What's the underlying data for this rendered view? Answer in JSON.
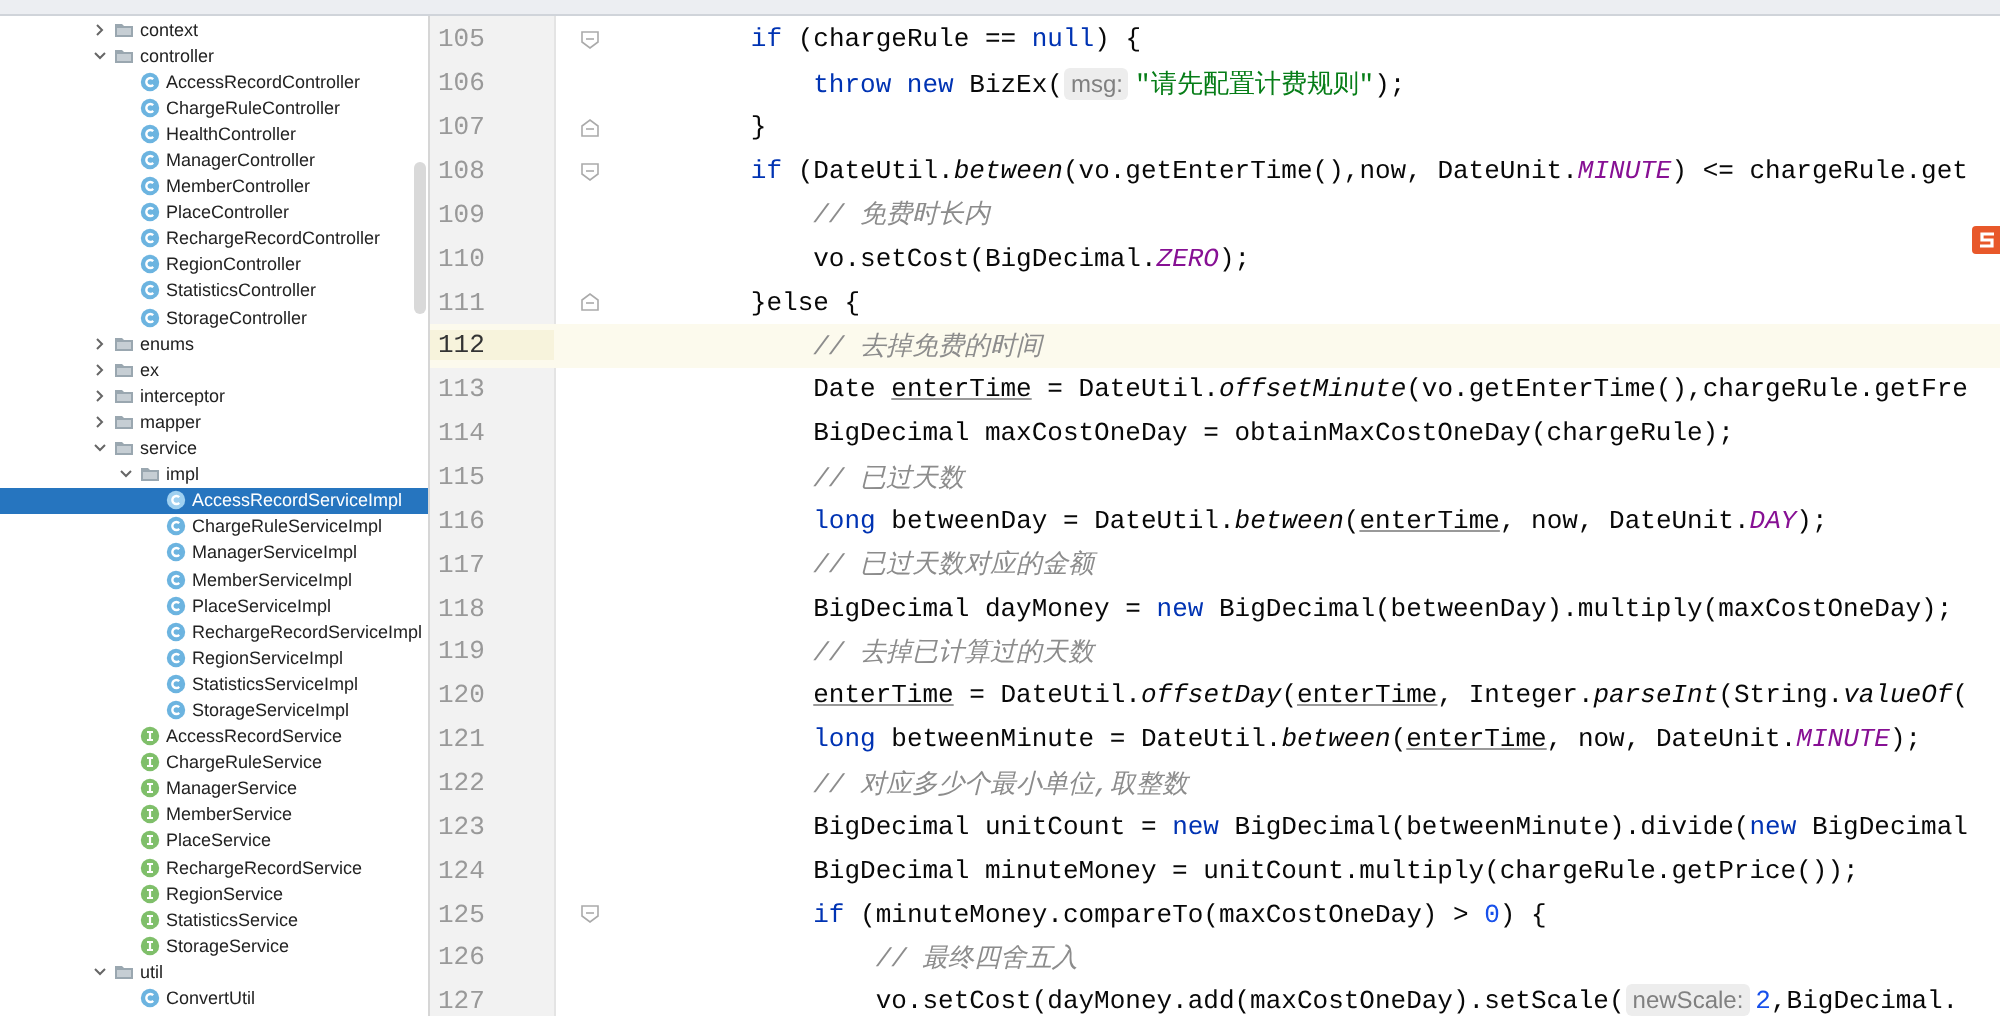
{
  "project_tree": [
    {
      "label": "context",
      "kind": "folder",
      "expanded": false,
      "selected": false
    },
    {
      "label": "controller",
      "kind": "folder",
      "expanded": true,
      "selected": false,
      "children": [
        {
          "label": "AccessRecordController",
          "kind": "class",
          "selected": false
        },
        {
          "label": "ChargeRuleController",
          "kind": "class",
          "selected": false
        },
        {
          "label": "HealthController",
          "kind": "class",
          "selected": false
        },
        {
          "label": "ManagerController",
          "kind": "class",
          "selected": false
        },
        {
          "label": "MemberController",
          "kind": "class",
          "selected": false
        },
        {
          "label": "PlaceController",
          "kind": "class",
          "selected": false
        },
        {
          "label": "RechargeRecordController",
          "kind": "class",
          "selected": false
        },
        {
          "label": "RegionController",
          "kind": "class",
          "selected": false
        },
        {
          "label": "StatisticsController",
          "kind": "class",
          "selected": false
        },
        {
          "label": "StorageController",
          "kind": "class",
          "selected": false
        }
      ]
    },
    {
      "label": "enums",
      "kind": "folder",
      "expanded": false,
      "selected": false
    },
    {
      "label": "ex",
      "kind": "folder",
      "expanded": false,
      "selected": false
    },
    {
      "label": "interceptor",
      "kind": "folder",
      "expanded": false,
      "selected": false
    },
    {
      "label": "mapper",
      "kind": "folder",
      "expanded": false,
      "selected": false
    },
    {
      "label": "service",
      "kind": "folder",
      "expanded": true,
      "selected": false,
      "children": [
        {
          "label": "impl",
          "kind": "folder",
          "expanded": true,
          "selected": false,
          "children": [
            {
              "label": "AccessRecordServiceImpl",
              "kind": "class",
              "selected": true
            },
            {
              "label": "ChargeRuleServiceImpl",
              "kind": "class",
              "selected": false
            },
            {
              "label": "ManagerServiceImpl",
              "kind": "class",
              "selected": false
            },
            {
              "label": "MemberServiceImpl",
              "kind": "class",
              "selected": false
            },
            {
              "label": "PlaceServiceImpl",
              "kind": "class",
              "selected": false
            },
            {
              "label": "RechargeRecordServiceImpl",
              "kind": "class",
              "selected": false
            },
            {
              "label": "RegionServiceImpl",
              "kind": "class",
              "selected": false
            },
            {
              "label": "StatisticsServiceImpl",
              "kind": "class",
              "selected": false
            },
            {
              "label": "StorageServiceImpl",
              "kind": "class",
              "selected": false
            }
          ]
        },
        {
          "label": "AccessRecordService",
          "kind": "interface",
          "selected": false
        },
        {
          "label": "ChargeRuleService",
          "kind": "interface",
          "selected": false
        },
        {
          "label": "ManagerService",
          "kind": "interface",
          "selected": false
        },
        {
          "label": "MemberService",
          "kind": "interface",
          "selected": false
        },
        {
          "label": "PlaceService",
          "kind": "interface",
          "selected": false
        },
        {
          "label": "RechargeRecordService",
          "kind": "interface",
          "selected": false
        },
        {
          "label": "RegionService",
          "kind": "interface",
          "selected": false
        },
        {
          "label": "StatisticsService",
          "kind": "interface",
          "selected": false
        },
        {
          "label": "StorageService",
          "kind": "interface",
          "selected": false
        }
      ]
    },
    {
      "label": "util",
      "kind": "folder",
      "expanded": true,
      "selected": false,
      "children": [
        {
          "label": "ConvertUtil",
          "kind": "class",
          "selected": false
        }
      ]
    }
  ],
  "editor": {
    "lines": [
      {
        "number": "105",
        "current": false,
        "fold_start": true,
        "tokens": [
          {
            "kind": "kw",
            "text": "        if"
          },
          {
            "kind": "text",
            "text": " (chargeRule == "
          },
          {
            "kind": "kw",
            "text": "null"
          },
          {
            "kind": "text",
            "text": ") {"
          }
        ]
      },
      {
        "number": "106",
        "current": false,
        "tokens": [
          {
            "kind": "kw",
            "text": "            throw new"
          },
          {
            "kind": "text",
            "text": " BizEx("
          },
          {
            "kind": "hint",
            "text": "msg:"
          },
          {
            "kind": "string",
            "text": "\"请先配置计费规则\""
          },
          {
            "kind": "text",
            "text": ");"
          }
        ]
      },
      {
        "number": "107",
        "current": false,
        "fold_end": true,
        "tokens": [
          {
            "kind": "text",
            "text": "        }"
          }
        ]
      },
      {
        "number": "108",
        "current": false,
        "fold_start": true,
        "tokens": [
          {
            "kind": "kw",
            "text": "        if"
          },
          {
            "kind": "text",
            "text": " (DateUtil."
          },
          {
            "kind": "static",
            "text": "between"
          },
          {
            "kind": "text",
            "text": "(vo.getEnterTime(),now, DateUnit."
          },
          {
            "kind": "const",
            "text": "MINUTE"
          },
          {
            "kind": "text",
            "text": ") <= chargeRule.get"
          }
        ]
      },
      {
        "number": "109",
        "current": false,
        "tokens": [
          {
            "kind": "comment",
            "text": "            // 免费时长内"
          }
        ]
      },
      {
        "number": "110",
        "current": false,
        "tokens": [
          {
            "kind": "text",
            "text": "            vo.setCost(BigDecimal."
          },
          {
            "kind": "const",
            "text": "ZERO"
          },
          {
            "kind": "text",
            "text": ");"
          }
        ]
      },
      {
        "number": "111",
        "current": false,
        "fold_end": true,
        "tokens": [
          {
            "kind": "text",
            "text": "        }else {"
          }
        ]
      },
      {
        "number": "112",
        "current": true,
        "tokens": [
          {
            "kind": "comment",
            "text": "            // 去掉免费的时间"
          }
        ]
      },
      {
        "number": "113",
        "current": false,
        "tokens": [
          {
            "kind": "text",
            "text": "            Date "
          },
          {
            "kind": "var",
            "text": "enterTime"
          },
          {
            "kind": "text",
            "text": " = DateUtil."
          },
          {
            "kind": "static",
            "text": "offsetMinute"
          },
          {
            "kind": "text",
            "text": "(vo.getEnterTime(),chargeRule.getFre"
          }
        ]
      },
      {
        "number": "114",
        "current": false,
        "tokens": [
          {
            "kind": "text",
            "text": "            BigDecimal maxCostOneDay = obtainMaxCostOneDay(chargeRule);"
          }
        ]
      },
      {
        "number": "115",
        "current": false,
        "tokens": [
          {
            "kind": "comment",
            "text": "            // 已过天数"
          }
        ]
      },
      {
        "number": "116",
        "current": false,
        "tokens": [
          {
            "kind": "kw",
            "text": "            long"
          },
          {
            "kind": "text",
            "text": " betweenDay = DateUtil."
          },
          {
            "kind": "static",
            "text": "between"
          },
          {
            "kind": "text",
            "text": "("
          },
          {
            "kind": "var",
            "text": "enterTime"
          },
          {
            "kind": "text",
            "text": ", now, DateUnit."
          },
          {
            "kind": "const",
            "text": "DAY"
          },
          {
            "kind": "text",
            "text": ");"
          }
        ]
      },
      {
        "number": "117",
        "current": false,
        "tokens": [
          {
            "kind": "comment",
            "text": "            // 已过天数对应的金额"
          }
        ]
      },
      {
        "number": "118",
        "current": false,
        "tokens": [
          {
            "kind": "text",
            "text": "            BigDecimal dayMoney = "
          },
          {
            "kind": "kw",
            "text": "new"
          },
          {
            "kind": "text",
            "text": " BigDecimal(betweenDay).multiply(maxCostOneDay);"
          }
        ]
      },
      {
        "number": "119",
        "current": false,
        "tokens": [
          {
            "kind": "comment",
            "text": "            // 去掉已计算过的天数"
          }
        ]
      },
      {
        "number": "120",
        "current": false,
        "tokens": [
          {
            "kind": "var",
            "text": "            enterTime"
          },
          {
            "kind": "text",
            "text": " = DateUtil."
          },
          {
            "kind": "static",
            "text": "offsetDay"
          },
          {
            "kind": "text",
            "text": "("
          },
          {
            "kind": "var",
            "text": "enterTime"
          },
          {
            "kind": "text",
            "text": ", Integer."
          },
          {
            "kind": "static",
            "text": "parseInt"
          },
          {
            "kind": "text",
            "text": "(String."
          },
          {
            "kind": "static",
            "text": "valueOf"
          },
          {
            "kind": "text",
            "text": "("
          }
        ]
      },
      {
        "number": "121",
        "current": false,
        "tokens": [
          {
            "kind": "kw",
            "text": "            long"
          },
          {
            "kind": "text",
            "text": " betweenMinute = DateUtil."
          },
          {
            "kind": "static",
            "text": "between"
          },
          {
            "kind": "text",
            "text": "("
          },
          {
            "kind": "var",
            "text": "enterTime"
          },
          {
            "kind": "text",
            "text": ", now, DateUnit."
          },
          {
            "kind": "const",
            "text": "MINUTE"
          },
          {
            "kind": "text",
            "text": ");"
          }
        ]
      },
      {
        "number": "122",
        "current": false,
        "tokens": [
          {
            "kind": "comment",
            "text": "            // 对应多少个最小单位,取整数"
          }
        ]
      },
      {
        "number": "123",
        "current": false,
        "tokens": [
          {
            "kind": "text",
            "text": "            BigDecimal unitCount = "
          },
          {
            "kind": "kw",
            "text": "new"
          },
          {
            "kind": "text",
            "text": " BigDecimal(betweenMinute).divide("
          },
          {
            "kind": "kw",
            "text": "new"
          },
          {
            "kind": "text",
            "text": " BigDecimal"
          }
        ]
      },
      {
        "number": "124",
        "current": false,
        "tokens": [
          {
            "kind": "text",
            "text": "            BigDecimal minuteMoney = unitCount.multiply(chargeRule.getPrice());"
          }
        ]
      },
      {
        "number": "125",
        "current": false,
        "fold_start": true,
        "tokens": [
          {
            "kind": "kw",
            "text": "            if"
          },
          {
            "kind": "text",
            "text": " (minuteMoney.compareTo(maxCostOneDay) > "
          },
          {
            "kind": "num",
            "text": "0"
          },
          {
            "kind": "text",
            "text": ") {"
          }
        ]
      },
      {
        "number": "126",
        "current": false,
        "tokens": [
          {
            "kind": "comment",
            "text": "                // 最终四舍五入"
          }
        ]
      },
      {
        "number": "127",
        "current": false,
        "tokens": [
          {
            "kind": "text",
            "text": "                vo.setCost(dayMoney.add(maxCostOneDay).setScale("
          },
          {
            "kind": "hint",
            "text": "newScale:"
          },
          {
            "kind": "num",
            "text": "2"
          },
          {
            "kind": "text",
            "text": ",BigDecimal."
          }
        ]
      }
    ]
  }
}
